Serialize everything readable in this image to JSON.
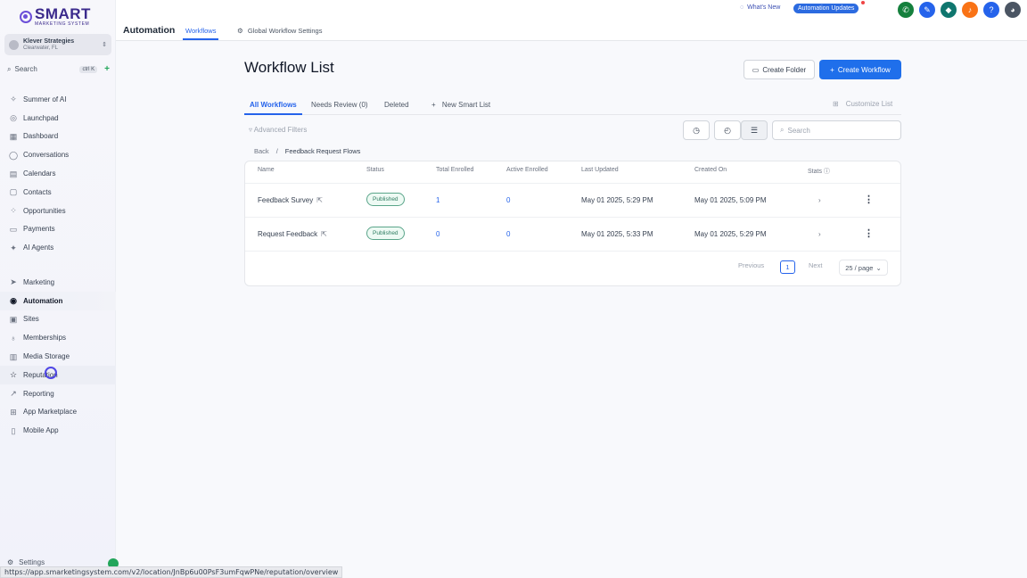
{
  "brand": {
    "name": "SMART",
    "tagline": "MARKETING SYSTEM",
    "color": "#3b2a8c"
  },
  "account": {
    "name": "Klever Strategies",
    "location": "Clearwater, FL"
  },
  "search": {
    "label": "Search",
    "shortcut": "ctrl K"
  },
  "sidebar": {
    "top_items": [
      {
        "label": "Summer of AI",
        "icon": "sparkle-icon"
      },
      {
        "label": "Launchpad",
        "icon": "rocket-icon"
      },
      {
        "label": "Dashboard",
        "icon": "grid-icon"
      },
      {
        "label": "Conversations",
        "icon": "chat-icon"
      },
      {
        "label": "Calendars",
        "icon": "calendar-icon"
      },
      {
        "label": "Contacts",
        "icon": "contacts-icon"
      },
      {
        "label": "Opportunities",
        "icon": "funnel-icon"
      },
      {
        "label": "Payments",
        "icon": "card-icon"
      },
      {
        "label": "AI Agents",
        "icon": "agent-icon"
      }
    ],
    "bottom_items": [
      {
        "label": "Marketing",
        "icon": "send-icon"
      },
      {
        "label": "Automation",
        "icon": "automation-icon"
      },
      {
        "label": "Sites",
        "icon": "sites-icon"
      },
      {
        "label": "Memberships",
        "icon": "membership-icon"
      },
      {
        "label": "Media Storage",
        "icon": "storage-icon"
      },
      {
        "label": "Reputation",
        "icon": "star-icon"
      },
      {
        "label": "Reporting",
        "icon": "chart-icon"
      },
      {
        "label": "App Marketplace",
        "icon": "apps-icon"
      },
      {
        "label": "Mobile App",
        "icon": "mobile-icon"
      }
    ],
    "settings_label": "Settings"
  },
  "topbar": {
    "whats_new": "What's New",
    "updates": "Automation Updates"
  },
  "subheader": {
    "title": "Automation",
    "tab_workflows": "Workflows",
    "tab_global": "Global Workflow Settings"
  },
  "main": {
    "title": "Workflow List",
    "create_folder": "Create Folder",
    "create_workflow": "Create Workflow",
    "tabs": [
      "All Workflows",
      "Needs Review (0)",
      "Deleted"
    ],
    "new_smart_list": "New Smart List",
    "customize_list": "Customize List",
    "advanced_filters": "Advanced Filters",
    "search_placeholder": "Search",
    "breadcrumb": {
      "back": "Back",
      "current": "Feedback Request Flows"
    }
  },
  "table": {
    "headers": [
      "Name",
      "Status",
      "Total Enrolled",
      "Active Enrolled",
      "Last Updated",
      "Created On",
      "Stats"
    ],
    "rows": [
      {
        "name": "Feedback Survey",
        "status": "Published",
        "total": "1",
        "active": "0",
        "updated": "May 01 2025, 5:29 PM",
        "created": "May 01 2025, 5:09 PM"
      },
      {
        "name": "Request Feedback",
        "status": "Published",
        "total": "0",
        "active": "0",
        "updated": "May 01 2025, 5:33 PM",
        "created": "May 01 2025, 5:29 PM"
      }
    ],
    "pagination": {
      "previous": "Previous",
      "page": "1",
      "next": "Next",
      "per_page": "25 / page"
    }
  },
  "status_url": "https://app.smarketingsystem.com/v2/location/JnBp6u00PsF3umFqwPNe/reputation/overview"
}
